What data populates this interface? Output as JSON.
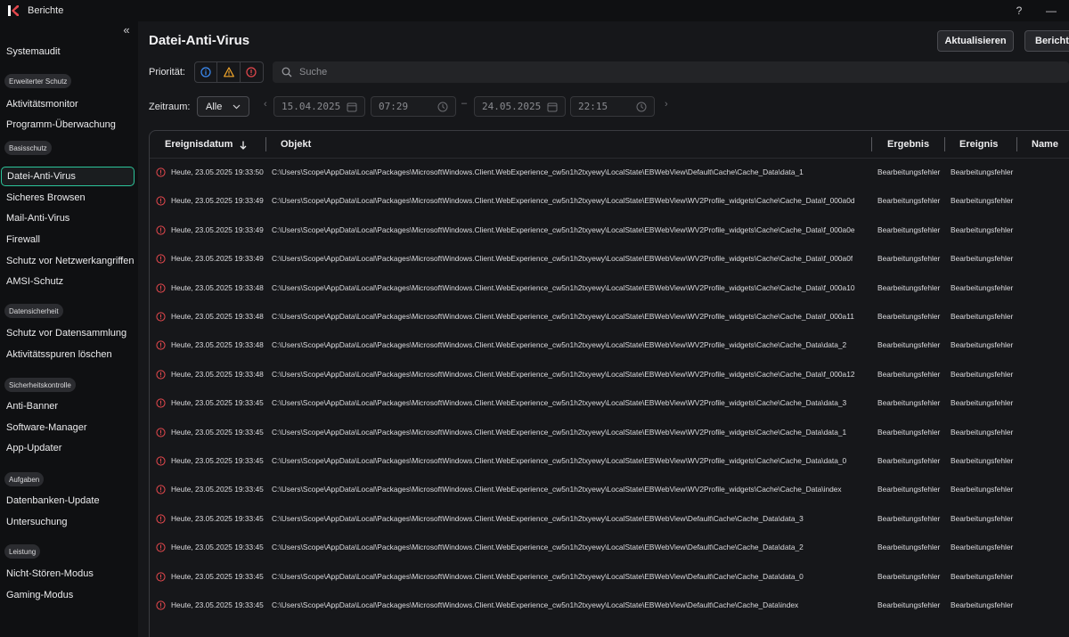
{
  "window": {
    "title": "Berichte",
    "help": "?",
    "minimize": "—"
  },
  "sidebar": {
    "collapse_icon": "chevron-double-left-icon",
    "items": [
      {
        "label": "Systemaudit",
        "type": "item"
      },
      {
        "label": "Erweiterter Schutz",
        "type": "section"
      },
      {
        "label": "Aktivitätsmonitor",
        "type": "item"
      },
      {
        "label": "Programm-Überwachung",
        "type": "item"
      },
      {
        "label": "Basisschutz",
        "type": "section"
      },
      {
        "label": "Datei-Anti-Virus",
        "type": "item",
        "active": true
      },
      {
        "label": "Sicheres Browsen",
        "type": "item"
      },
      {
        "label": "Mail-Anti-Virus",
        "type": "item"
      },
      {
        "label": "Firewall",
        "type": "item"
      },
      {
        "label": "Schutz vor Netzwerkangriffen",
        "type": "item"
      },
      {
        "label": "AMSI-Schutz",
        "type": "item"
      },
      {
        "label": "Datensicherheit",
        "type": "section"
      },
      {
        "label": "Schutz vor Datensammlung",
        "type": "item"
      },
      {
        "label": "Aktivitätsspuren löschen",
        "type": "item"
      },
      {
        "label": "Sicherheitskontrolle",
        "type": "section"
      },
      {
        "label": "Anti-Banner",
        "type": "item"
      },
      {
        "label": "Software-Manager",
        "type": "item"
      },
      {
        "label": "App-Updater",
        "type": "item"
      },
      {
        "label": "Aufgaben",
        "type": "section"
      },
      {
        "label": "Datenbanken-Update",
        "type": "item"
      },
      {
        "label": "Untersuchung",
        "type": "item"
      },
      {
        "label": "Leistung",
        "type": "section"
      },
      {
        "label": "Nicht-Stören-Modus",
        "type": "item"
      },
      {
        "label": "Gaming-Modus",
        "type": "item"
      }
    ]
  },
  "header": {
    "title": "Datei-Anti-Virus",
    "refresh_label": "Aktualisieren",
    "report_label": "Bericht s"
  },
  "filters": {
    "priority_label": "Priorität:",
    "priority_buttons": [
      "info-icon",
      "warning-icon",
      "error-icon"
    ],
    "search_placeholder": "Suche",
    "period_label": "Zeitraum:",
    "period_value": "Alle",
    "start_date": "15.04.2025",
    "start_time": "07:29",
    "end_date": "24.05.2025",
    "end_time": "22:15"
  },
  "colors": {
    "accent": "#2cc59a",
    "error": "#e5484d",
    "warning": "#f2a62b",
    "info": "#3b8cf5"
  },
  "table": {
    "columns": [
      "Ereignisdatum",
      "Objekt",
      "Ergebnis",
      "Ereignis",
      "Name"
    ],
    "sort_icon": "arrow-down-icon",
    "rows": [
      {
        "date": "Heute, 23.05.2025 19:33:50",
        "object": "C:\\Users\\Scope\\AppData\\Local\\Packages\\MicrosoftWindows.Client.WebExperience_cw5n1h2txyewy\\LocalState\\EBWebView\\Default\\Cache\\Cache_Data\\data_1",
        "result": "Bearbeitungsfehler",
        "event": "Bearbeitungsfehler"
      },
      {
        "date": "Heute, 23.05.2025 19:33:49",
        "object": "C:\\Users\\Scope\\AppData\\Local\\Packages\\MicrosoftWindows.Client.WebExperience_cw5n1h2txyewy\\LocalState\\EBWebView\\WV2Profile_widgets\\Cache\\Cache_Data\\f_000a0d",
        "result": "Bearbeitungsfehler",
        "event": "Bearbeitungsfehler"
      },
      {
        "date": "Heute, 23.05.2025 19:33:49",
        "object": "C:\\Users\\Scope\\AppData\\Local\\Packages\\MicrosoftWindows.Client.WebExperience_cw5n1h2txyewy\\LocalState\\EBWebView\\WV2Profile_widgets\\Cache\\Cache_Data\\f_000a0e",
        "result": "Bearbeitungsfehler",
        "event": "Bearbeitungsfehler"
      },
      {
        "date": "Heute, 23.05.2025 19:33:49",
        "object": "C:\\Users\\Scope\\AppData\\Local\\Packages\\MicrosoftWindows.Client.WebExperience_cw5n1h2txyewy\\LocalState\\EBWebView\\WV2Profile_widgets\\Cache\\Cache_Data\\f_000a0f",
        "result": "Bearbeitungsfehler",
        "event": "Bearbeitungsfehler"
      },
      {
        "date": "Heute, 23.05.2025 19:33:48",
        "object": "C:\\Users\\Scope\\AppData\\Local\\Packages\\MicrosoftWindows.Client.WebExperience_cw5n1h2txyewy\\LocalState\\EBWebView\\WV2Profile_widgets\\Cache\\Cache_Data\\f_000a10",
        "result": "Bearbeitungsfehler",
        "event": "Bearbeitungsfehler"
      },
      {
        "date": "Heute, 23.05.2025 19:33:48",
        "object": "C:\\Users\\Scope\\AppData\\Local\\Packages\\MicrosoftWindows.Client.WebExperience_cw5n1h2txyewy\\LocalState\\EBWebView\\WV2Profile_widgets\\Cache\\Cache_Data\\f_000a11",
        "result": "Bearbeitungsfehler",
        "event": "Bearbeitungsfehler"
      },
      {
        "date": "Heute, 23.05.2025 19:33:48",
        "object": "C:\\Users\\Scope\\AppData\\Local\\Packages\\MicrosoftWindows.Client.WebExperience_cw5n1h2txyewy\\LocalState\\EBWebView\\WV2Profile_widgets\\Cache\\Cache_Data\\data_2",
        "result": "Bearbeitungsfehler",
        "event": "Bearbeitungsfehler"
      },
      {
        "date": "Heute, 23.05.2025 19:33:48",
        "object": "C:\\Users\\Scope\\AppData\\Local\\Packages\\MicrosoftWindows.Client.WebExperience_cw5n1h2txyewy\\LocalState\\EBWebView\\WV2Profile_widgets\\Cache\\Cache_Data\\f_000a12",
        "result": "Bearbeitungsfehler",
        "event": "Bearbeitungsfehler"
      },
      {
        "date": "Heute, 23.05.2025 19:33:45",
        "object": "C:\\Users\\Scope\\AppData\\Local\\Packages\\MicrosoftWindows.Client.WebExperience_cw5n1h2txyewy\\LocalState\\EBWebView\\WV2Profile_widgets\\Cache\\Cache_Data\\data_3",
        "result": "Bearbeitungsfehler",
        "event": "Bearbeitungsfehler"
      },
      {
        "date": "Heute, 23.05.2025 19:33:45",
        "object": "C:\\Users\\Scope\\AppData\\Local\\Packages\\MicrosoftWindows.Client.WebExperience_cw5n1h2txyewy\\LocalState\\EBWebView\\WV2Profile_widgets\\Cache\\Cache_Data\\data_1",
        "result": "Bearbeitungsfehler",
        "event": "Bearbeitungsfehler"
      },
      {
        "date": "Heute, 23.05.2025 19:33:45",
        "object": "C:\\Users\\Scope\\AppData\\Local\\Packages\\MicrosoftWindows.Client.WebExperience_cw5n1h2txyewy\\LocalState\\EBWebView\\WV2Profile_widgets\\Cache\\Cache_Data\\data_0",
        "result": "Bearbeitungsfehler",
        "event": "Bearbeitungsfehler"
      },
      {
        "date": "Heute, 23.05.2025 19:33:45",
        "object": "C:\\Users\\Scope\\AppData\\Local\\Packages\\MicrosoftWindows.Client.WebExperience_cw5n1h2txyewy\\LocalState\\EBWebView\\WV2Profile_widgets\\Cache\\Cache_Data\\index",
        "result": "Bearbeitungsfehler",
        "event": "Bearbeitungsfehler"
      },
      {
        "date": "Heute, 23.05.2025 19:33:45",
        "object": "C:\\Users\\Scope\\AppData\\Local\\Packages\\MicrosoftWindows.Client.WebExperience_cw5n1h2txyewy\\LocalState\\EBWebView\\Default\\Cache\\Cache_Data\\data_3",
        "result": "Bearbeitungsfehler",
        "event": "Bearbeitungsfehler"
      },
      {
        "date": "Heute, 23.05.2025 19:33:45",
        "object": "C:\\Users\\Scope\\AppData\\Local\\Packages\\MicrosoftWindows.Client.WebExperience_cw5n1h2txyewy\\LocalState\\EBWebView\\Default\\Cache\\Cache_Data\\data_2",
        "result": "Bearbeitungsfehler",
        "event": "Bearbeitungsfehler"
      },
      {
        "date": "Heute, 23.05.2025 19:33:45",
        "object": "C:\\Users\\Scope\\AppData\\Local\\Packages\\MicrosoftWindows.Client.WebExperience_cw5n1h2txyewy\\LocalState\\EBWebView\\Default\\Cache\\Cache_Data\\data_0",
        "result": "Bearbeitungsfehler",
        "event": "Bearbeitungsfehler"
      },
      {
        "date": "Heute, 23.05.2025 19:33:45",
        "object": "C:\\Users\\Scope\\AppData\\Local\\Packages\\MicrosoftWindows.Client.WebExperience_cw5n1h2txyewy\\LocalState\\EBWebView\\Default\\Cache\\Cache_Data\\index",
        "result": "Bearbeitungsfehler",
        "event": "Bearbeitungsfehler"
      }
    ]
  }
}
